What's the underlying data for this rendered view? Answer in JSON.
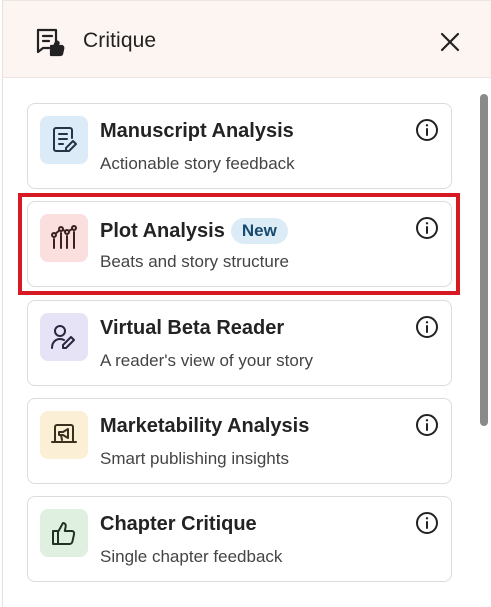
{
  "header": {
    "title": "Critique",
    "icon": "critique-feedback-icon",
    "close_icon": "close-icon"
  },
  "cards": [
    {
      "title": "Manuscript Analysis",
      "subtitle": "Actionable story feedback",
      "icon": "document-list-icon",
      "icon_bg": "#dcebf8",
      "badge": ""
    },
    {
      "title": "Plot Analysis",
      "subtitle": "Beats and story structure",
      "icon": "plot-graph-icon",
      "icon_bg": "#fbdede",
      "badge": "New"
    },
    {
      "title": "Virtual Beta Reader",
      "subtitle": "A reader's view of your story",
      "icon": "reader-edit-icon",
      "icon_bg": "#e6e3f6",
      "badge": ""
    },
    {
      "title": "Marketability Analysis",
      "subtitle": "Smart publishing insights",
      "icon": "marketing-icon",
      "icon_bg": "#fbf0d6",
      "badge": ""
    },
    {
      "title": "Chapter Critique",
      "subtitle": "Single chapter feedback",
      "icon": "thumbs-up-icon",
      "icon_bg": "#dff0e1",
      "badge": ""
    }
  ],
  "colors": {
    "highlight": "#d61a24",
    "header_bg": "#fdf5f1"
  }
}
